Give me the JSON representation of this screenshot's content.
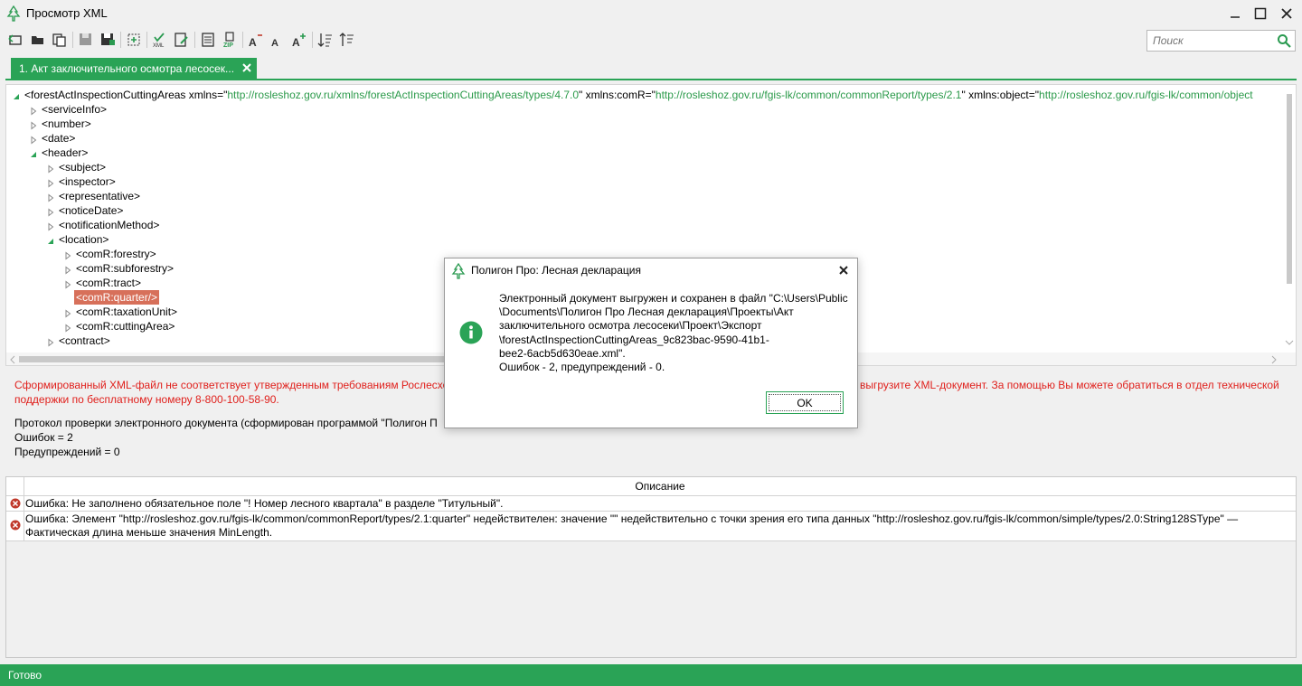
{
  "window": {
    "title": "Просмотр XML"
  },
  "search": {
    "placeholder": "Поиск"
  },
  "tabs": [
    {
      "label": "1. Акт заключительного осмотра лесосек..."
    }
  ],
  "tree": {
    "root": {
      "tag": "<forestActInspectionCuttingAreas ",
      "attr1_name": "xmlns=\"",
      "attr1_value": "http://rosleshoz.gov.ru/xmlns/forestActInspectionCuttingAreas/types/4.7.0",
      "attr2_name": "\" xmlns:comR=\"",
      "attr2_value": "http://rosleshoz.gov.ru/fgis-lk/common/commonReport/types/2.1",
      "attr3_name": "\" xmlns:object=\"",
      "attr3_value": "http://rosleshoz.gov.ru/fgis-lk/common/object"
    },
    "nodes": [
      {
        "label": "<serviceInfo>",
        "depth": 1,
        "expanded": false
      },
      {
        "label": "<number>",
        "depth": 1,
        "expanded": false
      },
      {
        "label": "<date>",
        "depth": 1,
        "expanded": false
      },
      {
        "label": "<header>",
        "depth": 1,
        "expanded": true
      },
      {
        "label": "<subject>",
        "depth": 2,
        "expanded": false
      },
      {
        "label": "<inspector>",
        "depth": 2,
        "expanded": false
      },
      {
        "label": "<representative>",
        "depth": 2,
        "expanded": false
      },
      {
        "label": "<noticeDate>",
        "depth": 2,
        "expanded": false
      },
      {
        "label": "<notificationMethod>",
        "depth": 2,
        "expanded": false
      },
      {
        "label": "<location>",
        "depth": 2,
        "expanded": true
      },
      {
        "label": "<comR:forestry>",
        "depth": 3,
        "expanded": false
      },
      {
        "label": "<comR:subforestry>",
        "depth": 3,
        "expanded": false
      },
      {
        "label": "<comR:tract>",
        "depth": 3,
        "expanded": false
      },
      {
        "label": "<comR:quarter/>",
        "depth": 3,
        "expanded": null,
        "highlighted": true
      },
      {
        "label": "<comR:taxationUnit>",
        "depth": 3,
        "expanded": false
      },
      {
        "label": "<comR:cuttingArea>",
        "depth": 3,
        "expanded": false
      },
      {
        "label": "<contract>",
        "depth": 2,
        "expanded": false
      }
    ]
  },
  "messages": {
    "error_line1": "Сформированный XML-файл не соответствует утвержденным требованиям Рослесхоз",
    "error_line1_tail": "выгрузите XML-документ. За помощью Вы можете обратиться в отдел технической",
    "error_line2": "поддержки по бесплатному номеру 8-800-100-58-90.",
    "protocol_line": "Протокол проверки электронного документа (сформирован программой \"Полигон П",
    "errors_count": "Ошибок = 2",
    "warnings_count": "Предупреждений = 0"
  },
  "grid": {
    "header": "Описание",
    "rows": [
      {
        "type": "error",
        "text": "Ошибка: Не заполнено обязательное поле \"! Номер лесного квартала\" в разделе \"Титульный\"."
      },
      {
        "type": "error",
        "text": "Ошибка: Элемент \"http://rosleshoz.gov.ru/fgis-lk/common/commonReport/types/2.1:quarter\" недействителен: значение \"\" недействительно с точки зрения его типа данных \"http://rosleshoz.gov.ru/fgis-lk/common/simple/types/2.0:String128SType\" — Фактическая длина меньше значения MinLength."
      }
    ]
  },
  "status": {
    "text": "Готово"
  },
  "dialog": {
    "title": "Полигон Про: Лесная декларация",
    "message_lines": [
      "Электронный документ выгружен и сохранен в файл \"C:\\Users\\Public",
      "\\Documents\\Полигон Про Лесная декларация\\Проекты\\Акт",
      "заключительного осмотра лесосеки\\Проект\\Экспорт",
      "\\forestActInspectionCuttingAreas_9c823bac-9590-41b1-",
      "bee2-6acb5d630eae.xml\".",
      "Ошибок - 2, предупреждений - 0."
    ],
    "ok_label": "OK"
  },
  "colors": {
    "accent": "#2aa356",
    "error_text": "#e0201c",
    "highlight": "#d7705a",
    "url": "#2b9a4a"
  }
}
